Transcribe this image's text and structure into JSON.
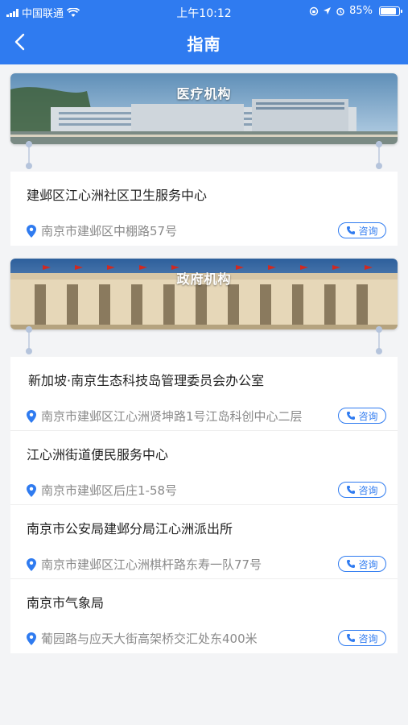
{
  "status_bar": {
    "carrier": "中国联通",
    "time": "上午10:12",
    "battery": "85%"
  },
  "nav": {
    "title": "指南"
  },
  "sections": [
    {
      "title": "医疗机构",
      "items": [
        {
          "name": "建邺区江心洲社区卫生服务中心",
          "address": "南京市建邺区中棚路57号",
          "button": "咨询"
        }
      ]
    },
    {
      "title": "政府机构",
      "items": [
        {
          "name": "新加坡·南京生态科技岛管理委员会办公室",
          "address": "南京市建邺区江心洲贤坤路1号江岛科创中心二层",
          "button": "咨询"
        },
        {
          "name": "江心洲街道便民服务中心",
          "address": "南京市建邺区后庄1-58号",
          "button": "咨询"
        },
        {
          "name": "南京市公安局建邺分局江心洲派出所",
          "address": "南京市建邺区江心洲棋杆路东寿一队77号",
          "button": "咨询"
        },
        {
          "name": "南京市气象局",
          "address": "葡园路与应天大街高架桥交汇处东400米",
          "button": "咨询"
        }
      ]
    }
  ],
  "colors": {
    "primary": "#2f7bf0",
    "background": "#f3f4f6"
  }
}
